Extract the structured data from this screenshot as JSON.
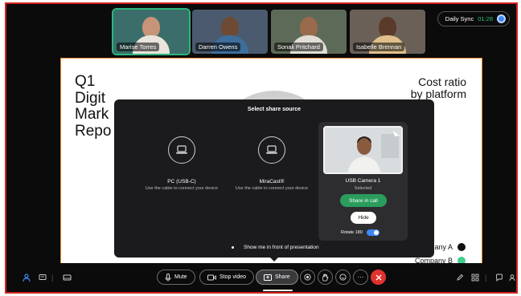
{
  "participants": [
    {
      "name": "Marise Torres",
      "bg": "#3b6e6a",
      "skin": "#c89478",
      "shirt": "#e9e4dc"
    },
    {
      "name": "Darren Owens",
      "bg": "#4b5a6e",
      "skin": "#6e4a34",
      "shirt": "#3d6e9c"
    },
    {
      "name": "Sonali Pritchard",
      "bg": "#5e6a58",
      "skin": "#9a6a4c",
      "shirt": "#e0ded6"
    },
    {
      "name": "Isabelle Brennan",
      "bg": "#6a6058",
      "skin": "#5a3a2a",
      "shirt": "#e0c08a"
    }
  ],
  "meeting": {
    "title": "Daily Sync",
    "timer": "01:28"
  },
  "slide": {
    "title_lines": [
      "Q1",
      "Digit",
      "Mark",
      "Repo"
    ],
    "right_title_lines": [
      "Cost ratio",
      "by platform"
    ],
    "legend": [
      {
        "label": "any A",
        "color": "#111111"
      },
      {
        "label": "Company B",
        "color": "#3ecf8e"
      }
    ]
  },
  "share_dialog": {
    "title": "Select share source",
    "sources": [
      {
        "name": "PC (USB-C)",
        "desc": "Use the cable to connect your device"
      },
      {
        "name": "MiraCast®",
        "desc": "Use the cable to connect your device"
      }
    ],
    "camera": {
      "name": "USB Camera 1",
      "status": "Selected",
      "share_label": "Share in call",
      "hide_label": "Hide",
      "rotate_label": "Rotate 180",
      "rotate_on": true
    },
    "show_me_label": "Show me in front of presentation"
  },
  "toolbar": {
    "mute_label": "Mute",
    "stop_video_label": "Stop video",
    "share_label": "Share"
  },
  "icons": {
    "participants": "person-icon",
    "chat": "chat-icon",
    "layout": "layout-icon",
    "mic": "microphone-icon",
    "video": "camera-icon",
    "share": "share-screen-icon",
    "record": "record-icon",
    "raise_hand": "hand-icon",
    "reactions": "smiley-icon",
    "more": "ellipsis-icon",
    "end": "close-icon",
    "annotate": "pen-icon",
    "apps": "apps-icon",
    "messages": "message-icon",
    "people": "people-icon"
  },
  "colors": {
    "accent_green": "#2a9d5c",
    "end_red": "#e0322d",
    "toggle_blue": "#3a89f5",
    "frame_red": "#d3241d"
  }
}
